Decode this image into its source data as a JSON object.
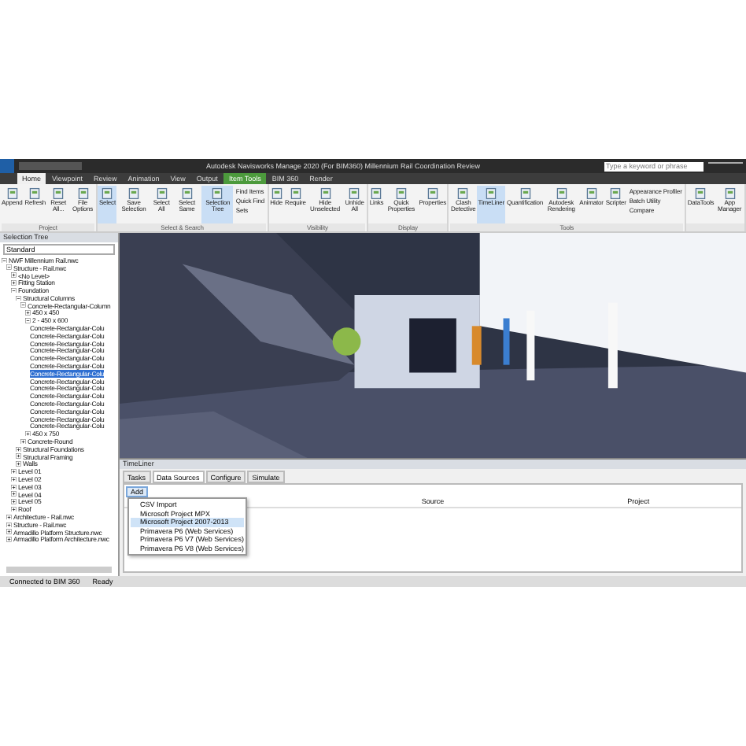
{
  "window": {
    "title": "Autodesk Navisworks Manage 2020 (For BIM360)   Millennium Rail Coordination Review",
    "search": {
      "placeholder": "Type a keyword or phrase"
    }
  },
  "tabs": [
    {
      "label": "Home",
      "selected": true
    },
    {
      "label": "Viewpoint",
      "selected": false
    },
    {
      "label": "Review",
      "selected": false
    },
    {
      "label": "Animation",
      "selected": false
    },
    {
      "label": "View",
      "selected": false
    },
    {
      "label": "Output",
      "selected": false
    },
    {
      "label": "Item Tools",
      "selected": false,
      "kind": "context"
    },
    {
      "label": "BIM 360",
      "selected": false
    },
    {
      "label": "Render",
      "selected": false
    }
  ],
  "ribbon": [
    {
      "label": "Project",
      "buttons": [
        {
          "label": "Append",
          "selected": false
        },
        {
          "label": "Refresh",
          "selected": false
        },
        {
          "label": "Reset All...",
          "selected": false
        },
        {
          "label": "File Options",
          "selected": false
        }
      ]
    },
    {
      "label": "Select & Search",
      "buttons": [
        {
          "label": "Select",
          "selected": true
        },
        {
          "label": "Save Selection",
          "selected": false
        },
        {
          "label": "Select All",
          "selected": false
        },
        {
          "label": "Select Same",
          "selected": false
        },
        {
          "label": "Selection Tree",
          "selected": true
        }
      ],
      "small": [
        "Find Items",
        "Quick Find",
        "Sets"
      ]
    },
    {
      "label": "Visibility",
      "buttons": [
        {
          "label": "Hide",
          "selected": false
        },
        {
          "label": "Require",
          "selected": false
        },
        {
          "label": "Hide Unselected",
          "selected": false
        },
        {
          "label": "Unhide All",
          "selected": false
        }
      ]
    },
    {
      "label": "Display",
      "buttons": [
        {
          "label": "Links",
          "selected": false
        },
        {
          "label": "Quick Properties",
          "selected": false
        },
        {
          "label": "Properties",
          "selected": false
        }
      ]
    },
    {
      "label": "Tools",
      "buttons": [
        {
          "label": "Clash Detective",
          "selected": false
        },
        {
          "label": "TimeLiner",
          "selected": true
        },
        {
          "label": "Quantification",
          "selected": false
        },
        {
          "label": "Autodesk Rendering",
          "selected": false
        },
        {
          "label": "Animator",
          "selected": false
        },
        {
          "label": "Scripter",
          "selected": false
        }
      ],
      "small": [
        "Appearance Profiler",
        "Batch Utility",
        "Compare"
      ]
    },
    {
      "buttons": [
        {
          "label": "DataTools",
          "selected": false
        },
        {
          "label": "App Manager",
          "selected": false
        }
      ]
    }
  ],
  "selection_tree": {
    "title": "Selection Tree",
    "mode": "Standard",
    "items": [
      {
        "label": "NWF Millennium Rail.nwc",
        "expanded": true,
        "selected": false,
        "children": [
          {
            "label": "Structure - Rail.nwc",
            "expanded": true,
            "selected": false,
            "children": [
              {
                "label": "<No Level>",
                "expanded": false,
                "selected": false
              },
              {
                "label": "Fitting Station",
                "expanded": false,
                "selected": false
              },
              {
                "label": "Foundation",
                "expanded": true,
                "selected": false,
                "children": [
                  {
                    "label": "Structural Columns",
                    "expanded": true,
                    "selected": false,
                    "children": [
                      {
                        "label": "Concrete-Rectangular-Column",
                        "expanded": true,
                        "selected": false,
                        "children": [
                          {
                            "label": "450 x 450",
                            "expanded": false,
                            "selected": false
                          },
                          {
                            "label": "2 - 450 x 600",
                            "expanded": true,
                            "selected": false,
                            "children": [
                              {
                                "label": "Concrete-Rectangular-Colu",
                                "selected": false
                              },
                              {
                                "label": "Concrete-Rectangular-Colu",
                                "selected": false
                              },
                              {
                                "label": "Concrete-Rectangular-Colu",
                                "selected": false
                              },
                              {
                                "label": "Concrete-Rectangular-Colu",
                                "selected": false
                              },
                              {
                                "label": "Concrete-Rectangular-Colu",
                                "selected": false
                              },
                              {
                                "label": "Concrete-Rectangular-Colu",
                                "selected": false
                              },
                              {
                                "label": "Concrete-Rectangular-Colu",
                                "selected": true
                              },
                              {
                                "label": "Concrete-Rectangular-Colu",
                                "selected": false
                              },
                              {
                                "label": "Concrete-Rectangular-Colu",
                                "selected": false
                              },
                              {
                                "label": "Concrete-Rectangular-Colu",
                                "selected": false
                              },
                              {
                                "label": "Concrete-Rectangular-Colu",
                                "selected": false
                              },
                              {
                                "label": "Concrete-Rectangular-Colu",
                                "selected": false
                              },
                              {
                                "label": "Concrete-Rectangular-Colu",
                                "selected": false
                              },
                              {
                                "label": "Concrete-Rectangular-Colu",
                                "selected": false
                              }
                            ]
                          },
                          {
                            "label": "450 x 750",
                            "expanded": false,
                            "selected": false
                          }
                        ]
                      },
                      {
                        "label": "Concrete-Round",
                        "expanded": false,
                        "selected": false
                      }
                    ]
                  },
                  {
                    "label": "Structural Foundations",
                    "expanded": false,
                    "selected": false
                  },
                  {
                    "label": "Structural Framing",
                    "expanded": false,
                    "selected": false
                  },
                  {
                    "label": "Walls",
                    "expanded": false,
                    "selected": false
                  }
                ]
              },
              {
                "label": "Level 01",
                "expanded": false,
                "selected": false
              },
              {
                "label": "Level 02",
                "expanded": false,
                "selected": false
              },
              {
                "label": "Level 03",
                "expanded": false,
                "selected": false
              },
              {
                "label": "Level 04",
                "expanded": false,
                "selected": false
              },
              {
                "label": "Level 05",
                "expanded": false,
                "selected": false
              },
              {
                "label": "Roof",
                "expanded": false,
                "selected": false
              }
            ]
          },
          {
            "label": "Architecture - Rail.nwc",
            "expanded": false,
            "selected": false
          },
          {
            "label": "Structure - Rail.nwc",
            "expanded": false,
            "selected": false
          },
          {
            "label": "Armadillo Platform Structure.nwc",
            "expanded": false,
            "selected": false
          },
          {
            "label": "Armadillo Platform Architecture.nwc",
            "expanded": false,
            "selected": false
          }
        ]
      }
    ]
  },
  "timeliner": {
    "title": "TimeLiner",
    "tabs": [
      {
        "label": "Tasks",
        "selected": false
      },
      {
        "label": "Data Sources",
        "selected": true
      },
      {
        "label": "Configure",
        "selected": false
      },
      {
        "label": "Simulate",
        "selected": false
      }
    ],
    "add_button": "Add",
    "menu": [
      {
        "label": "CSV Import",
        "selected": false
      },
      {
        "label": "Microsoft Project MPX",
        "selected": false
      },
      {
        "label": "Microsoft Project 2007-2013",
        "selected": true
      },
      {
        "label": "Primavera P6 (Web Services)",
        "selected": false
      },
      {
        "label": "Primavera P6 V7 (Web Services)",
        "selected": false
      },
      {
        "label": "Primavera P6 V8 (Web Services)",
        "selected": false
      }
    ],
    "columns": [
      "Source",
      "Project"
    ]
  },
  "status_bar": {
    "items": [
      "Connected to BIM 360",
      "Ready"
    ]
  }
}
